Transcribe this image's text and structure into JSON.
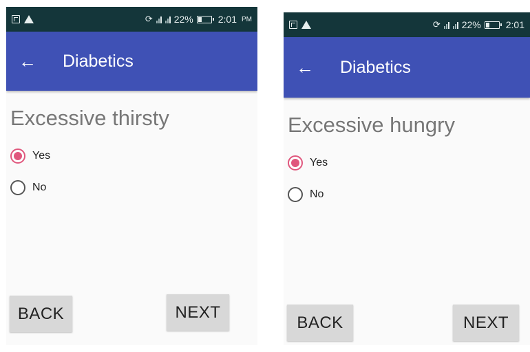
{
  "screens": [
    {
      "status": {
        "battery": "22%",
        "time": "2:01",
        "ampm": "PM",
        "icons": [
          "sim-icon",
          "warning-icon",
          "rotate-icon",
          "signal-icon",
          "signal-icon",
          "battery-icon"
        ]
      },
      "app_bar": {
        "title": "Diabetics",
        "back_icon": "back-arrow-icon"
      },
      "question": "Excessive thirsty",
      "options": [
        {
          "label": "Yes",
          "checked": true
        },
        {
          "label": "No",
          "checked": false
        }
      ],
      "buttons": {
        "back": "BACK",
        "next": "NEXT"
      }
    },
    {
      "status": {
        "battery": "22%",
        "time": "2:01",
        "ampm": "",
        "icons": [
          "sim-icon",
          "warning-icon",
          "rotate-icon",
          "signal-icon",
          "signal-icon",
          "battery-icon"
        ]
      },
      "app_bar": {
        "title": "Diabetics",
        "back_icon": "back-arrow-icon"
      },
      "question": "Excessive hungry",
      "options": [
        {
          "label": "Yes",
          "checked": true
        },
        {
          "label": "No",
          "checked": false
        }
      ],
      "buttons": {
        "back": "BACK",
        "next": "NEXT"
      }
    }
  ],
  "colors": {
    "status_bar": "#14363a",
    "app_bar": "#3f51b5",
    "accent": "#e0577d",
    "question_text": "#777777",
    "button_bg": "#d8d8d8"
  }
}
